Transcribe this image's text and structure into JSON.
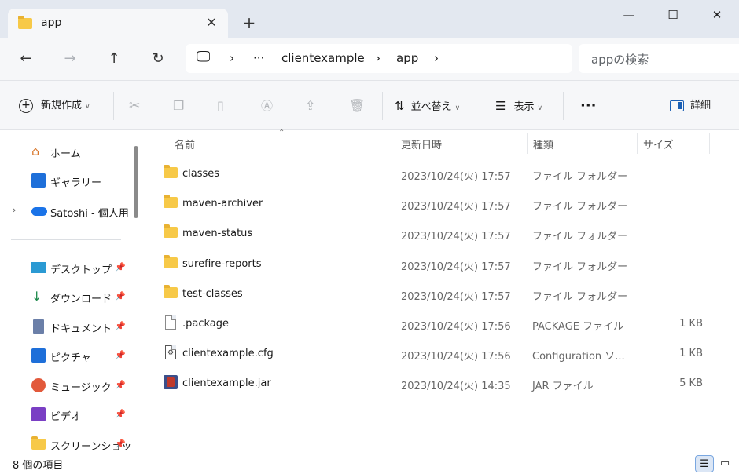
{
  "window": {
    "tab_title": "app",
    "new_tab": "+",
    "minimize": "—",
    "maximize": "☐",
    "close": "✕",
    "tab_close": "✕"
  },
  "nav": {
    "back": "←",
    "forward": "→",
    "up": "↑",
    "refresh": "↻",
    "breadcrumb": {
      "monitor": "🖵",
      "sep1": "›",
      "more": "···",
      "item1": "clientexample",
      "sep2": "›",
      "item2": "app",
      "sep3": "›"
    },
    "search_placeholder": "appの検索"
  },
  "toolbar": {
    "new": "新規作成",
    "sort": "並べ替え",
    "view": "表示",
    "more": "···",
    "details": "詳細"
  },
  "sidebar": {
    "items": [
      {
        "label": "ホーム",
        "icon": "home-icon"
      },
      {
        "label": "ギャラリー",
        "icon": "gallery-icon"
      },
      {
        "label": "Satoshi - 個人用",
        "icon": "onedrive-icon"
      }
    ],
    "pinned": [
      {
        "label": "デスクトップ",
        "icon": "desktop-icon"
      },
      {
        "label": "ダウンロード",
        "icon": "download-icon"
      },
      {
        "label": "ドキュメント",
        "icon": "documents-icon"
      },
      {
        "label": "ピクチャ",
        "icon": "pictures-icon"
      },
      {
        "label": "ミュージック",
        "icon": "music-icon"
      },
      {
        "label": "ビデオ",
        "icon": "video-icon"
      },
      {
        "label": "スクリーンショッ",
        "icon": "folder-icon"
      }
    ]
  },
  "columns": {
    "name": "名前",
    "date": "更新日時",
    "type": "種類",
    "size": "サイズ"
  },
  "files": [
    {
      "name": "classes",
      "date": "2023/10/24(火) 17:57",
      "type": "ファイル フォルダー",
      "size": "",
      "icon": "folder-icon"
    },
    {
      "name": "maven-archiver",
      "date": "2023/10/24(火) 17:57",
      "type": "ファイル フォルダー",
      "size": "",
      "icon": "folder-icon"
    },
    {
      "name": "maven-status",
      "date": "2023/10/24(火) 17:57",
      "type": "ファイル フォルダー",
      "size": "",
      "icon": "folder-icon"
    },
    {
      "name": "surefire-reports",
      "date": "2023/10/24(火) 17:57",
      "type": "ファイル フォルダー",
      "size": "",
      "icon": "folder-icon"
    },
    {
      "name": "test-classes",
      "date": "2023/10/24(火) 17:57",
      "type": "ファイル フォルダー",
      "size": "",
      "icon": "folder-icon"
    },
    {
      "name": ".package",
      "date": "2023/10/24(火) 17:56",
      "type": "PACKAGE ファイル",
      "size": "1 KB",
      "icon": "file-icon"
    },
    {
      "name": "clientexample.cfg",
      "date": "2023/10/24(火) 17:56",
      "type": "Configuration ソ...",
      "size": "1 KB",
      "icon": "config-file-icon"
    },
    {
      "name": "clientexample.jar",
      "date": "2023/10/24(火) 14:35",
      "type": "JAR ファイル",
      "size": "5 KB",
      "icon": "jar-file-icon"
    }
  ],
  "status": {
    "count": "8 個の項目"
  }
}
